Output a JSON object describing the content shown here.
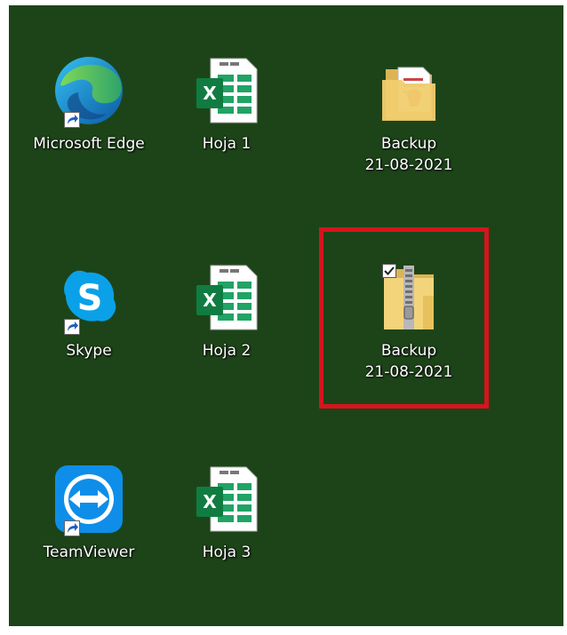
{
  "desktop": {
    "background": "#1d4418",
    "highlight_color": "#d7141e",
    "icons": [
      {
        "label": "Microsoft Edge",
        "icon": "edge-icon",
        "shortcut": true
      },
      {
        "label": "Hoja 1",
        "icon": "excel-file-icon"
      },
      {
        "label_line1": "Backup",
        "label_line2": "21-08-2021",
        "icon": "folder-icon"
      },
      {
        "label": "Skype",
        "icon": "skype-icon",
        "shortcut": true
      },
      {
        "label": "Hoja 2",
        "icon": "excel-file-icon"
      },
      {
        "label_line1": "Backup",
        "label_line2": "21-08-2021",
        "icon": "zip-folder-icon",
        "selected": true
      },
      {
        "label": "TeamViewer",
        "icon": "teamviewer-icon",
        "shortcut": true
      },
      {
        "label": "Hoja 3",
        "icon": "excel-file-icon"
      }
    ]
  }
}
